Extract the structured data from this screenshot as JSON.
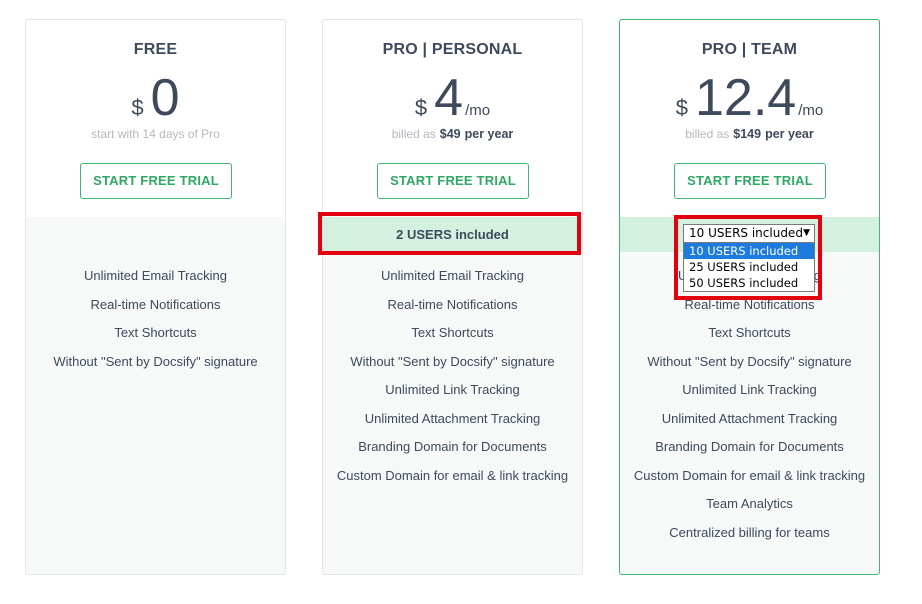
{
  "plans": [
    {
      "name": "FREE",
      "currency": "$",
      "amount": "0",
      "per": "",
      "sub_text": "start with 14 days of Pro",
      "cta_label": "START FREE TRIAL",
      "features": [
        "Unlimited Email Tracking",
        "Real-time Notifications",
        "Text Shortcuts",
        "Without \"Sent by Docsify\" signature"
      ]
    },
    {
      "name": "PRO | PERSONAL",
      "currency": "$",
      "amount": "4",
      "per": "/mo",
      "billed_prefix": "billed as",
      "billed_amount": "$49",
      "billed_suffix": "per year",
      "cta_label": "START FREE TRIAL",
      "users_label": "2 USERS included",
      "features": [
        "Unlimited Email Tracking",
        "Real-time Notifications",
        "Text Shortcuts",
        "Without \"Sent by Docsify\" signature",
        "Unlimited Link Tracking",
        "Unlimited Attachment Tracking",
        "Branding Domain for Documents",
        "Custom Domain for email & link tracking"
      ]
    },
    {
      "name": "PRO | TEAM",
      "currency": "$",
      "amount": "12.4",
      "per": "/mo",
      "billed_prefix": "billed as",
      "billed_amount": "$149",
      "billed_suffix": "per year",
      "cta_label": "START FREE TRIAL",
      "users_select": {
        "selected": "10 USERS included",
        "options": [
          "10 USERS included",
          "25 USERS included",
          "50 USERS included"
        ]
      },
      "features": [
        "Unlimited Email Tracking",
        "Real-time Notifications",
        "Text Shortcuts",
        "Without \"Sent by Docsify\" signature",
        "Unlimited Link Tracking",
        "Unlimited Attachment Tracking",
        "Branding Domain for Documents",
        "Custom Domain for email & link tracking",
        "Team Analytics",
        "Centralized billing for teams"
      ]
    }
  ],
  "colors": {
    "accent": "#3fb57a",
    "highlight": "#e3000f",
    "users_band": "#d4f0df",
    "dropdown_selected": "#1e7bde"
  }
}
